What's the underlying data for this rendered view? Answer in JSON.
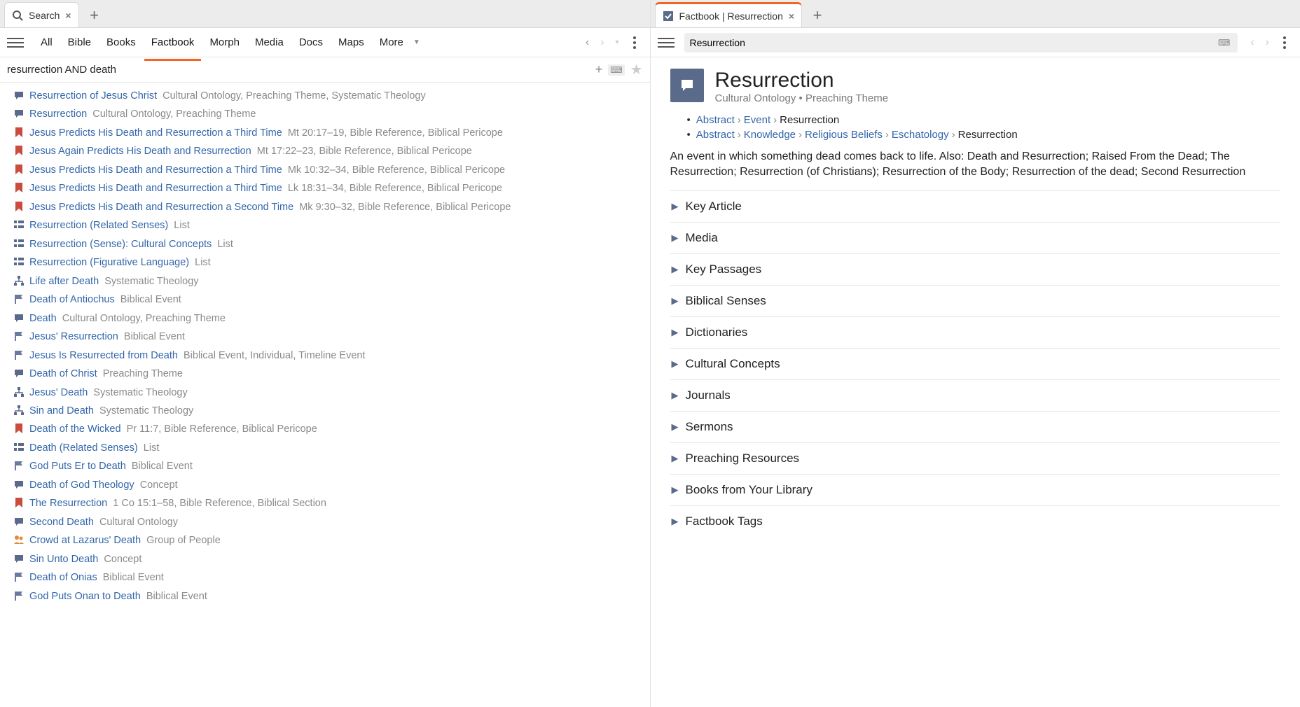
{
  "left": {
    "tab": {
      "label": "Search"
    },
    "toolbar": {
      "items": [
        "All",
        "Bible",
        "Books",
        "Factbook",
        "Morph",
        "Media",
        "Docs",
        "Maps",
        "More"
      ],
      "active_index": 3
    },
    "search_query": "resurrection AND death",
    "results": [
      {
        "icon": "speech",
        "title": "Resurrection of Jesus Christ",
        "meta": "Cultural Ontology, Preaching Theme, Systematic Theology"
      },
      {
        "icon": "speech",
        "title": "Resurrection",
        "meta": "Cultural Ontology, Preaching Theme"
      },
      {
        "icon": "bookmark",
        "title": "Jesus Predicts His Death and Resurrection a Third Time",
        "meta": "Mt 20:17–19, Bible Reference, Biblical Pericope"
      },
      {
        "icon": "bookmark",
        "title": "Jesus Again Predicts His Death and Resurrection",
        "meta": "Mt 17:22–23, Bible Reference, Biblical Pericope"
      },
      {
        "icon": "bookmark",
        "title": "Jesus Predicts His Death and Resurrection a Third Time",
        "meta": "Mk 10:32–34, Bible Reference, Biblical Pericope"
      },
      {
        "icon": "bookmark",
        "title": "Jesus Predicts His Death and Resurrection a Third Time",
        "meta": "Lk 18:31–34, Bible Reference, Biblical Pericope"
      },
      {
        "icon": "bookmark",
        "title": "Jesus Predicts His Death and Resurrection a Second Time",
        "meta": "Mk 9:30–32, Bible Reference, Biblical Pericope"
      },
      {
        "icon": "list",
        "title": "Resurrection (Related Senses)",
        "meta": "List"
      },
      {
        "icon": "list",
        "title": "Resurrection (Sense): Cultural Concepts",
        "meta": "List"
      },
      {
        "icon": "list",
        "title": "Resurrection (Figurative Language)",
        "meta": "List"
      },
      {
        "icon": "tree",
        "title": "Life after Death",
        "meta": "Systematic Theology"
      },
      {
        "icon": "flag",
        "title": "Death of Antiochus",
        "meta": "Biblical Event"
      },
      {
        "icon": "speech",
        "title": "Death",
        "meta": "Cultural Ontology, Preaching Theme"
      },
      {
        "icon": "flag",
        "title": "Jesus' Resurrection",
        "meta": "Biblical Event"
      },
      {
        "icon": "flag",
        "title": "Jesus Is Resurrected from Death",
        "meta": "Biblical Event, Individual, Timeline Event"
      },
      {
        "icon": "speech",
        "title": "Death of Christ",
        "meta": "Preaching Theme"
      },
      {
        "icon": "tree",
        "title": "Jesus' Death",
        "meta": "Systematic Theology"
      },
      {
        "icon": "tree",
        "title": "Sin and Death",
        "meta": "Systematic Theology"
      },
      {
        "icon": "bookmark",
        "title": "Death of the Wicked",
        "meta": "Pr 11:7, Bible Reference, Biblical Pericope"
      },
      {
        "icon": "list",
        "title": "Death (Related Senses)",
        "meta": "List"
      },
      {
        "icon": "flag",
        "title": "God Puts Er to Death",
        "meta": "Biblical Event"
      },
      {
        "icon": "speech",
        "title": "Death of God Theology",
        "meta": "Concept"
      },
      {
        "icon": "bookmark",
        "title": "The Resurrection",
        "meta": "1 Co 15:1–58, Bible Reference, Biblical Section"
      },
      {
        "icon": "speech",
        "title": "Second Death",
        "meta": "Cultural Ontology"
      },
      {
        "icon": "people",
        "title": "Crowd at Lazarus' Death",
        "meta": "Group of People"
      },
      {
        "icon": "speech",
        "title": "Sin Unto Death",
        "meta": "Concept"
      },
      {
        "icon": "flag",
        "title": "Death of Onias",
        "meta": "Biblical Event"
      },
      {
        "icon": "flag",
        "title": "God Puts Onan to Death",
        "meta": "Biblical Event"
      }
    ]
  },
  "right": {
    "tab": {
      "label": "Factbook | Resurrection"
    },
    "input_value": "Resurrection",
    "title": "Resurrection",
    "subtitle_parts": [
      "Cultural Ontology",
      "Preaching Theme"
    ],
    "breadcrumbs1": [
      {
        "t": "Abstract",
        "link": true
      },
      {
        "t": "Event",
        "link": true
      },
      {
        "t": "Resurrection",
        "link": false
      }
    ],
    "breadcrumbs2": [
      {
        "t": "Abstract",
        "link": true
      },
      {
        "t": "Knowledge",
        "link": true
      },
      {
        "t": "Religious Beliefs",
        "link": true
      },
      {
        "t": "Eschatology",
        "link": true
      },
      {
        "t": "Resurrection",
        "link": false
      }
    ],
    "description": "An event in which something dead comes back to life. Also: Death and Resurrection; Raised From the Dead; The Resurrection; Resurrection (of Christians); Resurrection of the Body; Resurrection of the dead; Second Resurrection",
    "sections": [
      "Key Article",
      "Media",
      "Key Passages",
      "Biblical Senses",
      "Dictionaries",
      "Cultural Concepts",
      "Journals",
      "Sermons",
      "Preaching Resources",
      "Books from Your Library",
      "Factbook Tags"
    ]
  }
}
